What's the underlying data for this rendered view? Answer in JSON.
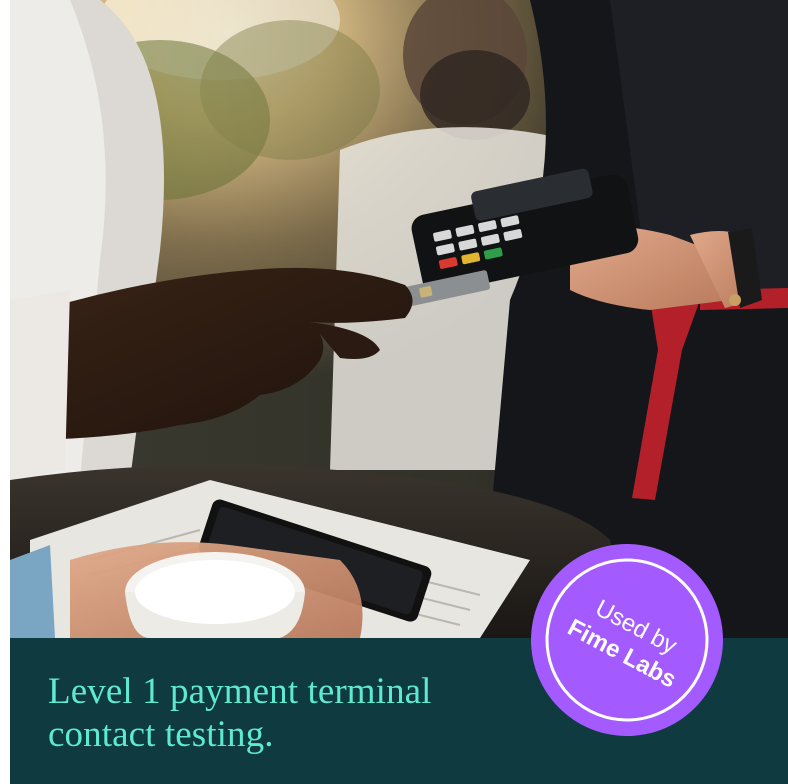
{
  "headline": {
    "line1": "Level 1 payment terminal",
    "line2": "contact testing."
  },
  "badge": {
    "line1": "Used by",
    "line2": "Fime Labs"
  },
  "photo": {
    "subject": "hand tapping a payment card on a card terminal held by a waitress"
  },
  "colors": {
    "panel": "#0f3a3f",
    "headline": "#5eead0",
    "badge": "#a35bff",
    "badge_text": "#ffffff"
  }
}
